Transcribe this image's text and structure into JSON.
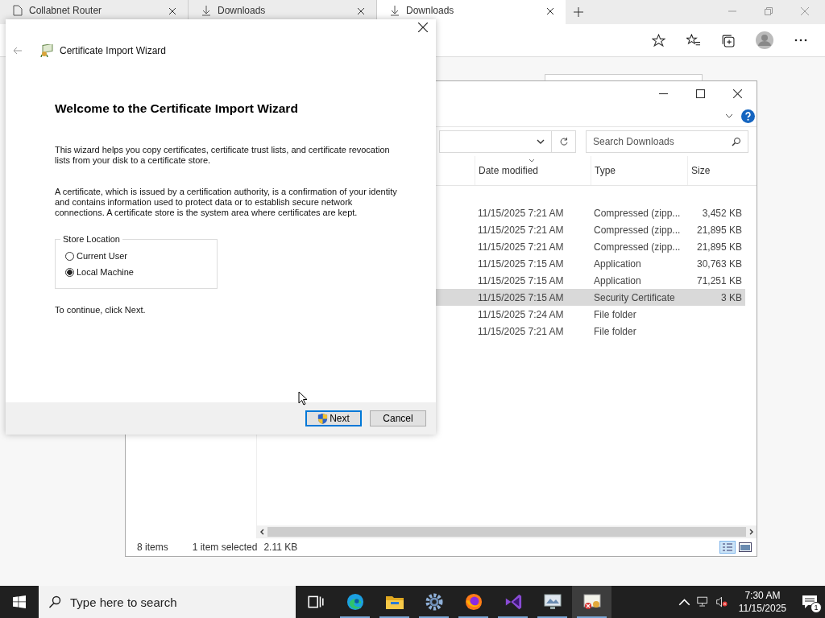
{
  "browser": {
    "tabs": [
      {
        "title": "Collabnet Router",
        "selected": false
      },
      {
        "title": "Downloads",
        "selected": false
      },
      {
        "title": "Downloads",
        "selected": true
      }
    ]
  },
  "explorer": {
    "search": {
      "placeholder": "Search Downloads"
    },
    "columns": [
      "Date modified",
      "Type",
      "Size"
    ],
    "rows": [
      {
        "date": "11/15/2025 7:21 AM",
        "type": "Compressed (zipp...",
        "size": "3,452 KB",
        "selected": false
      },
      {
        "date": "11/15/2025 7:21 AM",
        "type": "Compressed (zipp...",
        "size": "21,895 KB",
        "selected": false
      },
      {
        "date": "11/15/2025 7:21 AM",
        "type": "Compressed (zipp...",
        "size": "21,895 KB",
        "selected": false
      },
      {
        "date": "11/15/2025 7:15 AM",
        "type": "Application",
        "size": "30,763 KB",
        "selected": false
      },
      {
        "date": "11/15/2025 7:15 AM",
        "type": "Application",
        "size": "71,251 KB",
        "selected": false
      },
      {
        "date": "11/15/2025 7:15 AM",
        "type": "Security Certificate",
        "size": "3 KB",
        "selected": true
      },
      {
        "date": "11/15/2025 7:24 AM",
        "type": "File folder",
        "size": "",
        "selected": false
      },
      {
        "date": "11/15/2025 7:21 AM",
        "type": "File folder",
        "size": "",
        "selected": false
      }
    ],
    "status": {
      "count": "8 items",
      "selection": "1 item selected",
      "size": "2.11 KB"
    }
  },
  "dialog": {
    "title": "Certificate Import Wizard",
    "heading": "Welcome to the Certificate Import Wizard",
    "paragraphs": [
      "This wizard helps you copy certificates, certificate trust lists, and certificate revocation lists from your disk to a certificate store.",
      "A certificate, which is issued by a certification authority, is a confirmation of your identity and contains information used to protect data or to establish secure network connections. A certificate store is the system area where certificates are kept."
    ],
    "store_location": {
      "label": "Store Location",
      "options": [
        {
          "label": "Current User",
          "selected": false
        },
        {
          "label": "Local Machine",
          "selected": true
        }
      ]
    },
    "hint": "To continue, click Next.",
    "buttons": [
      {
        "label": "Next",
        "kind": "primary"
      },
      {
        "label": "Cancel",
        "kind": "normal"
      }
    ]
  },
  "taskbar": {
    "search_placeholder": "Type here to search",
    "apps": [
      {
        "kind": "task-view",
        "running": false,
        "active": false
      },
      {
        "kind": "edge",
        "running": true,
        "active": false
      },
      {
        "kind": "folder",
        "running": true,
        "active": false
      },
      {
        "kind": "gear",
        "running": true,
        "active": false
      },
      {
        "kind": "firefox",
        "running": true,
        "active": false
      },
      {
        "kind": "studio",
        "running": true,
        "active": false
      },
      {
        "kind": "monitor",
        "running": true,
        "active": false
      },
      {
        "kind": "certificate",
        "running": true,
        "active": true
      }
    ],
    "time": "7:30 AM",
    "date": "11/15/2025",
    "notifications": "1"
  }
}
